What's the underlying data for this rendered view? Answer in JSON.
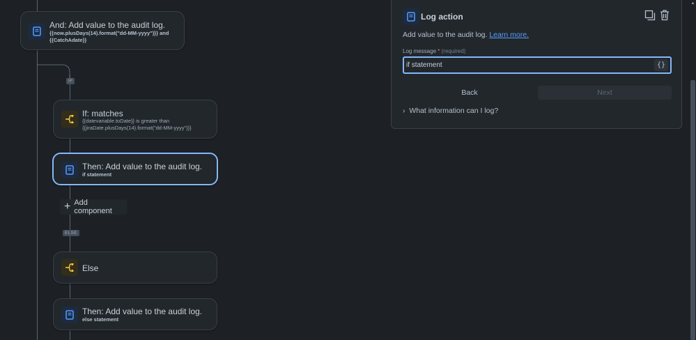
{
  "flow": {
    "and_card": {
      "title": "And: Add value to the audit log.",
      "sub_line1": "{{now.plusDays(14).format(\"dd-MM-yyyy\")}} and",
      "sub_line2": "{{CatchAdate}}"
    },
    "if_label": "IF",
    "if_card": {
      "title": "If: matches",
      "sub_line1": "{{datevariable.toDate}} is greater than",
      "sub_line2": "{{jiraDate.plusDays(14).format(\"dd-MM-yyyy\")}}"
    },
    "then_card_1": {
      "title": "Then: Add value to the audit log.",
      "sub": "if statement"
    },
    "add_component": "Add component",
    "else_label": "ELSE",
    "else_card": {
      "title": "Else"
    },
    "then_card_2": {
      "title": "Then: Add value to the audit log.",
      "sub": "else statement"
    }
  },
  "panel": {
    "title": "Log action",
    "description": "Add value to the audit log.",
    "learn_more": "Learn more.",
    "field_label": "Log message",
    "required_mark": "*",
    "required_text": "(required)",
    "input_value": "if statement",
    "smart_value_btn": "{}",
    "back_label": "Back",
    "next_label": "Next",
    "expander_label": "What information can I log?"
  },
  "colors": {
    "background": "#1d2125",
    "card": "#22272b",
    "selected_border": "#85b8ff",
    "action_icon": "#579dff",
    "condition_icon": "#f5cd47",
    "link": "#579dff"
  },
  "icons": {
    "action": "audit-log-document-icon",
    "condition": "branch-condition-icon",
    "duplicate": "duplicate-icon",
    "delete": "trash-icon",
    "expand": "chevron-right-icon",
    "add": "plus-icon"
  }
}
